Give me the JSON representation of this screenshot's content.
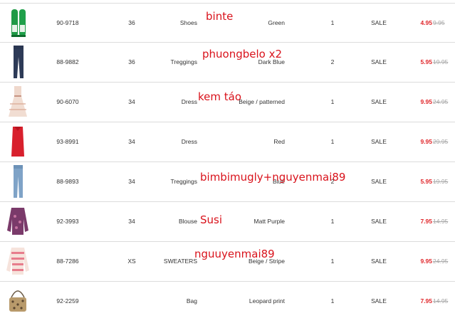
{
  "accent_colors": {
    "price": "#e0262a",
    "note": "#d9121b",
    "old_price": "#a7a7a7"
  },
  "rows": [
    {
      "image": "green-shoes-icon",
      "article": "90-9718",
      "size": "36",
      "type": "Shoes",
      "color": "Green",
      "qty": "1",
      "status": "SALE",
      "price": "4.95",
      "old_price": "9.95",
      "note": "binte"
    },
    {
      "image": "dark-treggings-icon",
      "article": "88-9882",
      "size": "36",
      "type": "Treggings",
      "color": "Dark Blue",
      "qty": "2",
      "status": "SALE",
      "price": "5.95",
      "old_price": "19.95",
      "note": "phuongbelo x2"
    },
    {
      "image": "beige-dress-icon",
      "article": "90-6070",
      "size": "34",
      "type": "Dress",
      "color": "Beige / patterned",
      "qty": "1",
      "status": "SALE",
      "price": "9.95",
      "old_price": "24.95",
      "note": "kem táo"
    },
    {
      "image": "red-dress-icon",
      "article": "93-8991",
      "size": "34",
      "type": "Dress",
      "color": "Red",
      "qty": "1",
      "status": "SALE",
      "price": "9.95",
      "old_price": "29.95",
      "note": ""
    },
    {
      "image": "blue-treggings-icon",
      "article": "88-9893",
      "size": "34",
      "type": "Treggings",
      "color": "Blue",
      "qty": "2",
      "status": "SALE",
      "price": "5.95",
      "old_price": "19.95",
      "note": "bimbimugly+nguyenmai89"
    },
    {
      "image": "purple-blouse-icon",
      "article": "92-3993",
      "size": "34",
      "type": "Blouse",
      "color": "Matt Purple",
      "qty": "1",
      "status": "SALE",
      "price": "7.95",
      "old_price": "14.95",
      "note": "Susi"
    },
    {
      "image": "striped-sweater-icon",
      "article": "88-7286",
      "size": "XS",
      "type": "SWEATERS",
      "color": "Beige / Stripe",
      "qty": "1",
      "status": "SALE",
      "price": "9.95",
      "old_price": "24.95",
      "note": "nguuyenmai89"
    },
    {
      "image": "leopard-bag-icon",
      "article": "92-2259",
      "size": "",
      "type": "Bag",
      "color": "Leopard print",
      "qty": "1",
      "status": "SALE",
      "price": "7.95",
      "old_price": "14.95",
      "note": ""
    }
  ]
}
